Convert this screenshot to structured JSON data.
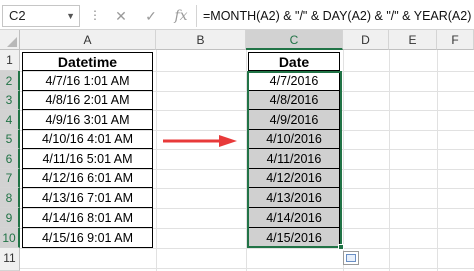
{
  "formula_bar": {
    "name_box": "C2",
    "cancel_icon": "✕",
    "enter_icon": "✓",
    "fx_icon": "fx",
    "formula": "=MONTH(A2) & \"/\" & DAY(A2) & \"/\" & YEAR(A2)"
  },
  "columns": [
    "A",
    "B",
    "C",
    "D",
    "E",
    "F"
  ],
  "rows": [
    "1",
    "2",
    "3",
    "4",
    "5",
    "6",
    "7",
    "8",
    "9",
    "10",
    "11"
  ],
  "table_a": {
    "header": "Datetime",
    "values": [
      "4/7/16 1:01 AM",
      "4/8/16 2:01 AM",
      "4/9/16 3:01 AM",
      "4/10/16 4:01 AM",
      "4/11/16 5:01 AM",
      "4/12/16 6:01 AM",
      "4/13/16 7:01 AM",
      "4/14/16 8:01 AM",
      "4/15/16 9:01 AM"
    ]
  },
  "table_c": {
    "header": "Date",
    "values": [
      "4/7/2016",
      "4/8/2016",
      "4/9/2016",
      "4/10/2016",
      "4/11/2016",
      "4/12/2016",
      "4/13/2016",
      "4/14/2016",
      "4/15/2016"
    ]
  },
  "colors": {
    "accent": "#217346",
    "arrow": "#e83a3a",
    "selection_fill": "#d0d0d0"
  }
}
